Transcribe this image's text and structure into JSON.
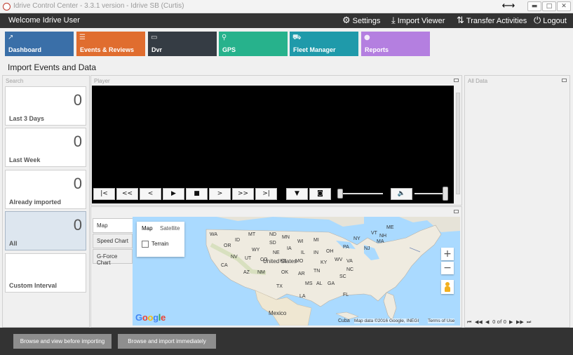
{
  "window": {
    "title": "Idrive Control Center - 3.3.1 version - Idrive SB (Curtis)",
    "resize_glyph": "⟷",
    "min_glyph": "▬",
    "max_glyph": "□",
    "close_glyph": "✕"
  },
  "header": {
    "welcome": "Welcome Idrive User",
    "settings": {
      "label": "Settings",
      "icon": "gear-icon",
      "glyph": "⚙"
    },
    "import_viewer": {
      "label": "Import Viewer",
      "icon": "download-icon",
      "glyph": "⤓"
    },
    "transfer": {
      "label": "Transfer Activities",
      "icon": "transfer-icon",
      "glyph": "⇅"
    },
    "logout": {
      "label": "Logout",
      "icon": "power-icon",
      "glyph": "⏻"
    }
  },
  "tiles": [
    {
      "label": "Dashboard",
      "color": "#3a6fa8",
      "glyph": "↗"
    },
    {
      "label": "Events & Reviews",
      "color": "#e06d2f",
      "glyph": "☰"
    },
    {
      "label": "Dvr",
      "color": "#353c44",
      "glyph": "▭"
    },
    {
      "label": "GPS",
      "color": "#27b28c",
      "glyph": "⚲"
    },
    {
      "label": "Fleet Manager",
      "color": "#1f9aaa",
      "glyph": "⛟"
    },
    {
      "label": "Reports",
      "color": "#b47fe0",
      "glyph": "●"
    }
  ],
  "section_title": "Import Events and Data",
  "search": {
    "label": "Search",
    "cards": [
      {
        "count": "0",
        "label": "Last 3 Days"
      },
      {
        "count": "0",
        "label": "Last Week"
      },
      {
        "count": "0",
        "label": "Already imported"
      },
      {
        "count": "0",
        "label": "All"
      },
      {
        "count": "",
        "label": "Custom Interval"
      }
    ]
  },
  "player": {
    "label": "Player",
    "controls": {
      "first": "|<",
      "rewind": "<<",
      "prev": "<",
      "play": "▶",
      "stop": "■",
      "next": ">",
      "forward": ">>",
      "last": ">|",
      "download": "▼",
      "snapshot": "◙",
      "volume": "🔈"
    },
    "progress": 0,
    "volume_level": 1
  },
  "charts": {
    "tabs": [
      "Map",
      "Speed Chart",
      "G-Force Chart"
    ]
  },
  "map": {
    "type_map": "Map",
    "type_satellite": "Satellite",
    "terrain": "Terrain",
    "zoom_in": "+",
    "zoom_out": "−",
    "labels": {
      "united_states": "United States",
      "mexico": "Mexico",
      "cuba": "Cuba",
      "ne": "NE",
      "nd": "ND",
      "ia": "IA",
      "mn": "MN",
      "wi": "WI",
      "mi": "MI",
      "il": "IL",
      "in": "IN",
      "oh": "OH",
      "pa": "PA",
      "ny": "NY",
      "ky": "KY",
      "tn": "TN",
      "nc": "NC",
      "va": "VA",
      "ga": "GA",
      "al": "AL",
      "ms": "MS",
      "la": "LA",
      "ar": "AR",
      "mo": "MO",
      "ks": "KS",
      "ok": "OK",
      "tx": "TX",
      "nm": "NM",
      "az": "AZ",
      "co": "CO",
      "ut": "UT",
      "nv": "NV",
      "ca": "CA",
      "or": "OR",
      "wa": "WA",
      "id": "ID",
      "mt": "MT",
      "wy": "WY",
      "sd": "SD",
      "me": "ME",
      "vt": "VT",
      "nh": "NH",
      "ma": "MA",
      "nj": "NJ",
      "fl": "FL",
      "sc": "SC",
      "wv": "WV"
    },
    "google": "Google",
    "attribution": "Map data ©2016 Google, INEGI",
    "terms": "Terms of Use"
  },
  "all_data": {
    "label": "All Data",
    "pager": {
      "first": "⏮",
      "prev_page": "◀◀",
      "prev": "◀",
      "info": "0 of 0",
      "next": "▶",
      "next_page": "▶▶",
      "last": "⏭"
    }
  },
  "footer": {
    "browse_view": "Browse and view before importing",
    "browse_import": "Browse and import immediately"
  }
}
